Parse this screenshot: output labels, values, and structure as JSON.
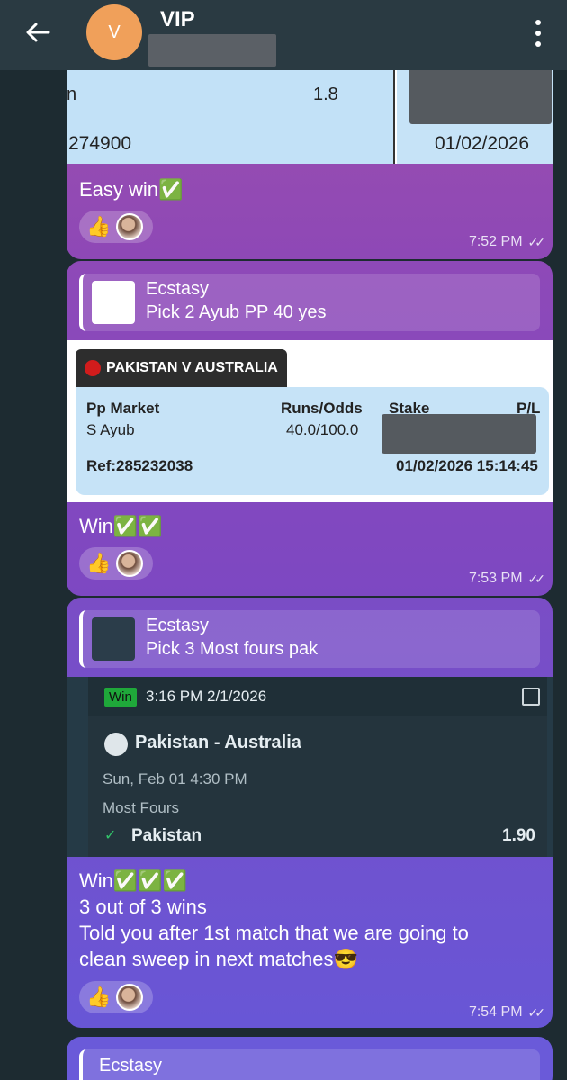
{
  "header": {
    "title": "VIP",
    "avatar_letter": "V"
  },
  "message1": {
    "slip_fragments": {
      "frag_left_num": "274900",
      "frag_odds": "1.8",
      "frag_date": "01/02/2026",
      "frag_n": "n"
    },
    "text": "Easy win✅",
    "time": "7:52 PM"
  },
  "message2": {
    "quote_name": "Ecstasy",
    "quote_text": "Pick 2 Ayub PP 40 yes",
    "slip": {
      "match": "PAKISTAN V AUSTRALIA",
      "col_market": "Pp Market",
      "col_runs": "Runs/Odds",
      "col_stake": "Stake",
      "col_pl": "P/L",
      "player": "S Ayub",
      "runs_odds": "40.0/100.0",
      "ref": "Ref:285232038",
      "datetime": "01/02/2026 15:14:45"
    },
    "text": "Win✅✅",
    "time": "7:53 PM"
  },
  "message3": {
    "quote_name": "Ecstasy",
    "quote_text": "Pick 3 Most fours pak",
    "card": {
      "badge": "Win",
      "timestamp": "3:16 PM 2/1/2026",
      "match": "Pakistan - Australia",
      "date": "Sun, Feb 01   4:30 PM",
      "market": "Most Fours",
      "selection": "Pakistan",
      "odds": "1.90"
    },
    "text_line1": "Win✅✅✅",
    "text_line2": "3 out of 3 wins",
    "text_line3": "Told you after 1st match that we are going to",
    "text_line4": "clean sweep in next matches😎",
    "time": "7:54 PM"
  },
  "message4": {
    "quote_name": "Ecstasy"
  },
  "reactions": {
    "emoji": "👍"
  }
}
